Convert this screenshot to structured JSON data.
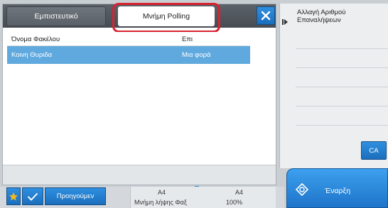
{
  "tabs": {
    "trusted_label": "Εμπιστευτικό",
    "polling_label": "Μνήμη Polling"
  },
  "list": {
    "headers": [
      "Όνομα Φακέλου",
      "Επι"
    ],
    "rows": [
      [
        "Κοινη Θυριδα",
        "Μια φορά"
      ]
    ]
  },
  "right_panel": {
    "repeat_label": "Αλλαγή Αριθμού Επαναλήψεων"
  },
  "buttons": {
    "ca": "CA",
    "start": "Έναρξη",
    "previous": "Προηγούμεν"
  },
  "status": {
    "paper_left": "A4",
    "paper_right": "A4",
    "fax_memory": "Μνήμη λήψης Φαξ",
    "percent": "100%"
  },
  "colors": {
    "accent_blue": "#1e74c9",
    "selected_row": "#5fa9de",
    "highlight_red": "#d8232f"
  }
}
